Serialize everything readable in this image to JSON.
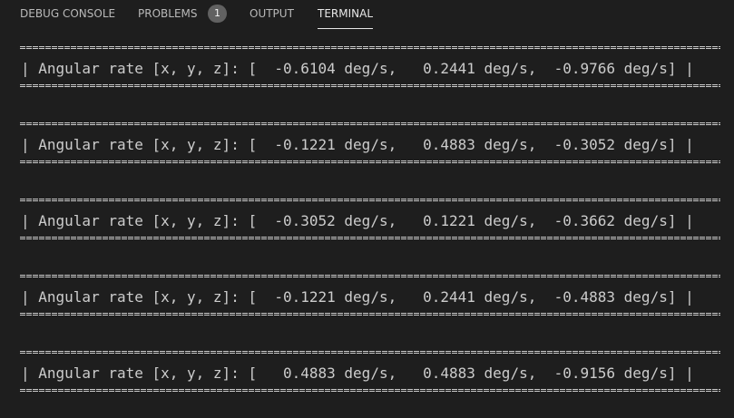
{
  "tabs": [
    {
      "label": "DEBUG CONSOLE"
    },
    {
      "label": "PROBLEMS",
      "badge": "1"
    },
    {
      "label": "OUTPUT"
    },
    {
      "label": "TERMINAL",
      "active": true
    }
  ],
  "terminal": {
    "lines": [
      "| Angular rate [x, y, z]: [  -0.6104 deg/s,   0.2441 deg/s,  -0.9766 deg/s] |",
      "| Angular rate [x, y, z]: [  -0.1221 deg/s,   0.4883 deg/s,  -0.3052 deg/s] |",
      "| Angular rate [x, y, z]: [  -0.3052 deg/s,   0.1221 deg/s,  -0.3662 deg/s] |",
      "| Angular rate [x, y, z]: [  -0.1221 deg/s,   0.2441 deg/s,  -0.4883 deg/s] |",
      "| Angular rate [x, y, z]: [   0.4883 deg/s,   0.4883 deg/s,  -0.9156 deg/s] |"
    ]
  },
  "colors": {
    "background": "#1e1e1e",
    "text": "#cccccc",
    "tab_active": "#e7e7e7",
    "tab_inactive": "#b9b9b9",
    "badge_bg": "#616161"
  }
}
